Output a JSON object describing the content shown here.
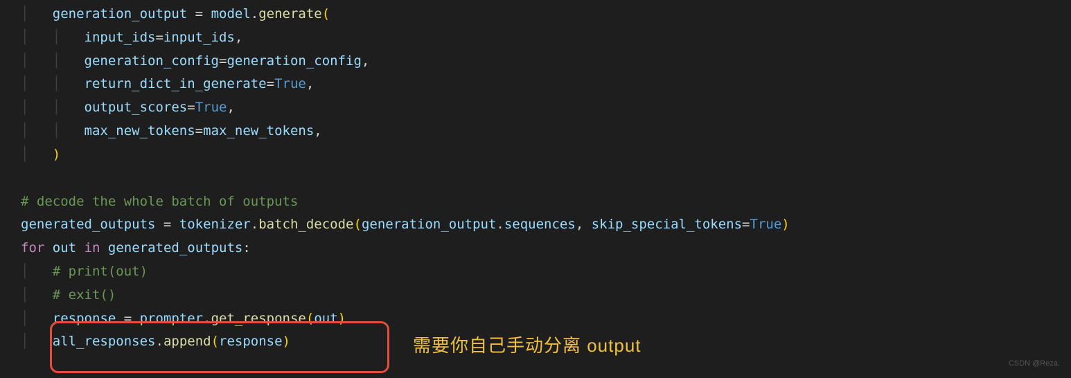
{
  "code": {
    "line1": {
      "var": "generation_output",
      "eq": " = ",
      "obj": "model",
      "dot": ".",
      "method": "generate",
      "paren": "("
    },
    "line2": {
      "arg": "input_ids",
      "eq": "=",
      "val": "input_ids",
      "comma": ","
    },
    "line3": {
      "arg": "generation_config",
      "eq": "=",
      "val": "generation_config",
      "comma": ","
    },
    "line4": {
      "arg": "return_dict_in_generate",
      "eq": "=",
      "val": "True",
      "comma": ","
    },
    "line5": {
      "arg": "output_scores",
      "eq": "=",
      "val": "True",
      "comma": ","
    },
    "line6": {
      "arg": "max_new_tokens",
      "eq": "=",
      "val": "max_new_tokens",
      "comma": ","
    },
    "line7": {
      "paren": ")"
    },
    "line8": "",
    "line9": {
      "comment": "# decode the whole batch of outputs"
    },
    "line10": {
      "var": "generated_outputs",
      "eq": " = ",
      "obj": "tokenizer",
      "dot": ".",
      "method": "batch_decode",
      "paren1": "(",
      "arg1": "generation_output",
      "dot2": ".",
      "prop": "sequences",
      "comma": ", ",
      "arg2": "skip_special_tokens",
      "eq2": "=",
      "val2": "True",
      "paren2": ")"
    },
    "line11": {
      "kw1": "for",
      "sp1": " ",
      "var": "out",
      "sp2": " ",
      "kw2": "in",
      "sp3": " ",
      "iter": "generated_outputs",
      "colon": ":"
    },
    "line12": {
      "comment": "# print(out)"
    },
    "line13": {
      "comment": "# exit()"
    },
    "line14": {
      "var": "response",
      "eq": " = ",
      "obj": "prompter",
      "dot": ".",
      "method": "get_response",
      "paren1": "(",
      "arg": "out",
      "paren2": ")"
    },
    "line15": {
      "obj": "all_responses",
      "dot": ".",
      "method": "append",
      "paren1": "(",
      "arg": "response",
      "paren2": ")"
    }
  },
  "annotation": "需要你自己手动分离 output",
  "watermark": "CSDN @Reza."
}
